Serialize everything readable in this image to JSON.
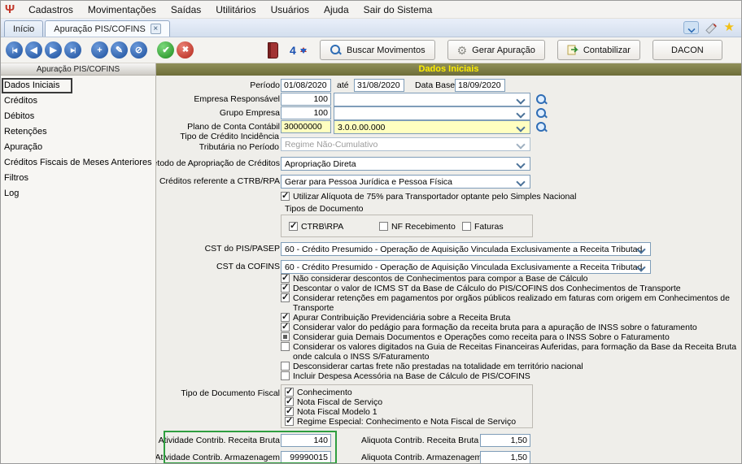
{
  "menu": {
    "items": [
      "Cadastros",
      "Movimentações",
      "Saídas",
      "Utilitários",
      "Usuários",
      "Ajuda",
      "Sair do Sistema"
    ]
  },
  "tabs": {
    "inicio": "Início",
    "apuracao": "Apuração PIS/COFINS"
  },
  "toolbar": {
    "buscar_label": "Buscar Movimentos",
    "gerar_label": "Gerar Apuração",
    "contabilizar_label": "Contabilizar",
    "dacon_label": "DACON"
  },
  "icons": {
    "app_logo": "Ψ",
    "nav_first": "|◀",
    "nav_prev": "◀",
    "nav_next": "▶",
    "nav_last": "▶|",
    "add": "+",
    "edit": "✎",
    "delete": "⊘",
    "confirm": "✔",
    "cancel": "✖",
    "report_four": "4",
    "gear": "⚙",
    "star": "★",
    "tab_close": "×"
  },
  "sidebar": {
    "title": "Apuração PIS/COFINS",
    "items": [
      "Dados Iniciais",
      "Créditos",
      "Débitos",
      "Retenções",
      "Apuração",
      "Créditos Fiscais de Meses Anteriores",
      "Filtros",
      "Log"
    ]
  },
  "main": {
    "title": "Dados Iniciais"
  },
  "colors": {
    "header_bg": "#6d6d38",
    "header_text": "#ffee00",
    "highlight_input": "#ffffc0",
    "annotation_green": "#2f9e3f",
    "annotation_black": "#3a3a3a"
  },
  "form": {
    "periodo": {
      "label": "Período",
      "from": "01/08/2020",
      "ate": "até",
      "to": "31/08/2020",
      "data_base_label": "Data Base",
      "data_base": "18/09/2020"
    },
    "empresa": {
      "label": "Empresa Responsável",
      "code": "100",
      "name": ""
    },
    "grupo": {
      "label": "Grupo Empresa",
      "code": "100",
      "name": ""
    },
    "plano": {
      "label": "Plano de Conta Contábil",
      "code": "30000000",
      "name": "3.0.0.00.000"
    },
    "tipo_credito": {
      "label": "Tipo de Crédito Incidência Tributária no Período",
      "value": "Regime Não-Cumulativo"
    },
    "metodo": {
      "label": "Método de Apropriação de Créditos",
      "value": "Apropriação Direta"
    },
    "creditos_ctrb": {
      "label": "Créditos referente a CTRB/RPA",
      "value": "Gerar para Pessoa Jurídica e Pessoa Física"
    },
    "aliquota75": {
      "label": "Utilizar Alíquota de 75% para Transportador optante pelo Simples Nacional",
      "state": "checked"
    },
    "tipos_documento": {
      "label": "Tipos de Documento",
      "items": [
        {
          "label": "CTRB\\RPA",
          "state": "checked"
        },
        {
          "label": "NF Recebimento",
          "state": "unchecked"
        },
        {
          "label": "Faturas",
          "state": "unchecked"
        }
      ]
    },
    "cst_pis": {
      "label": "CST do PIS/PASEP",
      "value": "60 - Crédito Presumido - Operação de Aquisição Vinculada Exclusivamente a Receita Tributad"
    },
    "cst_cofins": {
      "label": "CST da COFINS",
      "value": "60 - Crédito Presumido - Operação de Aquisição Vinculada Exclusivamente a Receita Tributad"
    },
    "options": [
      {
        "label": "Não considerar descontos de Conhecimentos para compor a Base de Cálculo",
        "state": "checked"
      },
      {
        "label": "Descontar o valor de ICMS ST da Base de Cálculo do PIS/COFINS dos Conhecimentos de Transporte",
        "state": "checked"
      },
      {
        "label": "Considerar retenções em pagamentos por orgãos públicos realizado em faturas com origem em Conhecimentos de Transporte",
        "state": "checked"
      },
      {
        "label": "Apurar Contribuição Previdenciária sobre a Receita Bruta",
        "state": "checked"
      },
      {
        "label": "Considerar valor do pedágio para formação da receita bruta para a apuração de INSS sobre o faturamento",
        "state": "checked"
      },
      {
        "label": "Considerar guia Demais Documentos e Operações como receita para o INSS Sobre o Faturamento",
        "state": "indeterminate"
      },
      {
        "label": "Considerar os valores digitados na Guia de Receitas Financeiras Auferidas, para formação da Base da Receita Bruta onde calcula o INSS S/Faturamento",
        "state": "unchecked"
      },
      {
        "label": "Desconsiderar cartas frete não prestadas na totalidade em território nacional",
        "state": "unchecked"
      },
      {
        "label": "Incluir Despesa Acessória na Base de Cálculo de PIS/COFINS",
        "state": "unchecked"
      }
    ],
    "tipo_doc_fiscal": {
      "label": "Tipo de Documento Fiscal",
      "items": [
        {
          "label": "Conhecimento",
          "state": "checked"
        },
        {
          "label": "Nota Fiscal de Serviço",
          "state": "checked"
        },
        {
          "label": "Nota Fiscal Modelo 1",
          "state": "checked"
        },
        {
          "label": "Regime Especial: Conhecimento e Nota Fiscal de Serviço",
          "state": "checked"
        }
      ]
    },
    "bottom": {
      "atividade_rb_label": "Atividade Contrib. Receita Bruta",
      "atividade_rb": "140",
      "aliquota_rb_label": "Aliquota Contrib. Receita Bruta",
      "aliquota_rb": "1,50",
      "atividade_arm_label": "Atividade Contrib. Armazenagem",
      "atividade_arm": "99990015",
      "aliquota_arm_label": "Aliquota Contrib. Armazenagem",
      "aliquota_arm": "1,50"
    }
  }
}
